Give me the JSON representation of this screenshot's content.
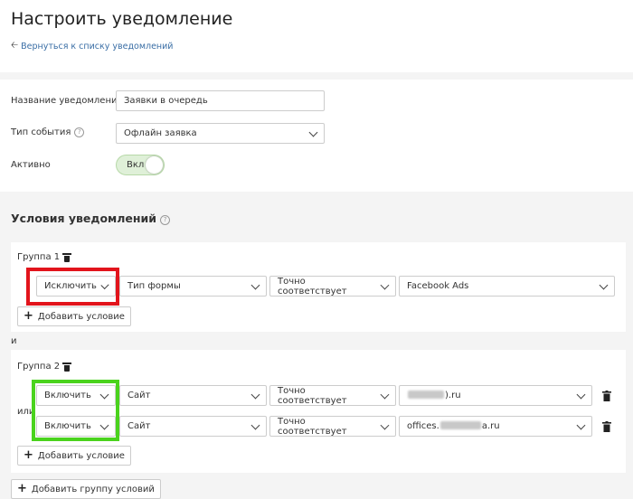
{
  "header": {
    "title": "Настроить уведомление",
    "back_link": "Вернуться к списку уведомлений"
  },
  "form": {
    "name_label": "Название уведомления",
    "name_value": "Заявки в очередь",
    "event_label": "Тип события",
    "event_value": "Офлайн заявка",
    "active_label": "Активно",
    "active_toggle": "Вкл"
  },
  "conditions": {
    "title": "Условия уведомлений",
    "connector_and": "и",
    "connector_or": "или",
    "add_group_label": "Добавить группу условий",
    "groups": [
      {
        "title": "Группа 1",
        "add_condition": "Добавить условие",
        "rows": [
          {
            "mode": "Исключить",
            "field": "Тип формы",
            "operator": "Точно соответствует",
            "value": "Facebook Ads"
          }
        ]
      },
      {
        "title": "Группа 2",
        "add_condition": "Добавить условие",
        "rows": [
          {
            "mode": "Включить",
            "field": "Сайт",
            "operator": "Точно соответствует",
            "value_suffix": ").ru"
          },
          {
            "mode": "Включить",
            "field": "Сайт",
            "operator": "Точно соответствует",
            "value_prefix": "offices.",
            "value_suffix": "a.ru"
          }
        ]
      }
    ]
  },
  "colors": {
    "highlight_red": "#e2141c",
    "highlight_green": "#4ad31d",
    "toggle_on": "#dff0d8",
    "link": "#3a6ea5"
  }
}
